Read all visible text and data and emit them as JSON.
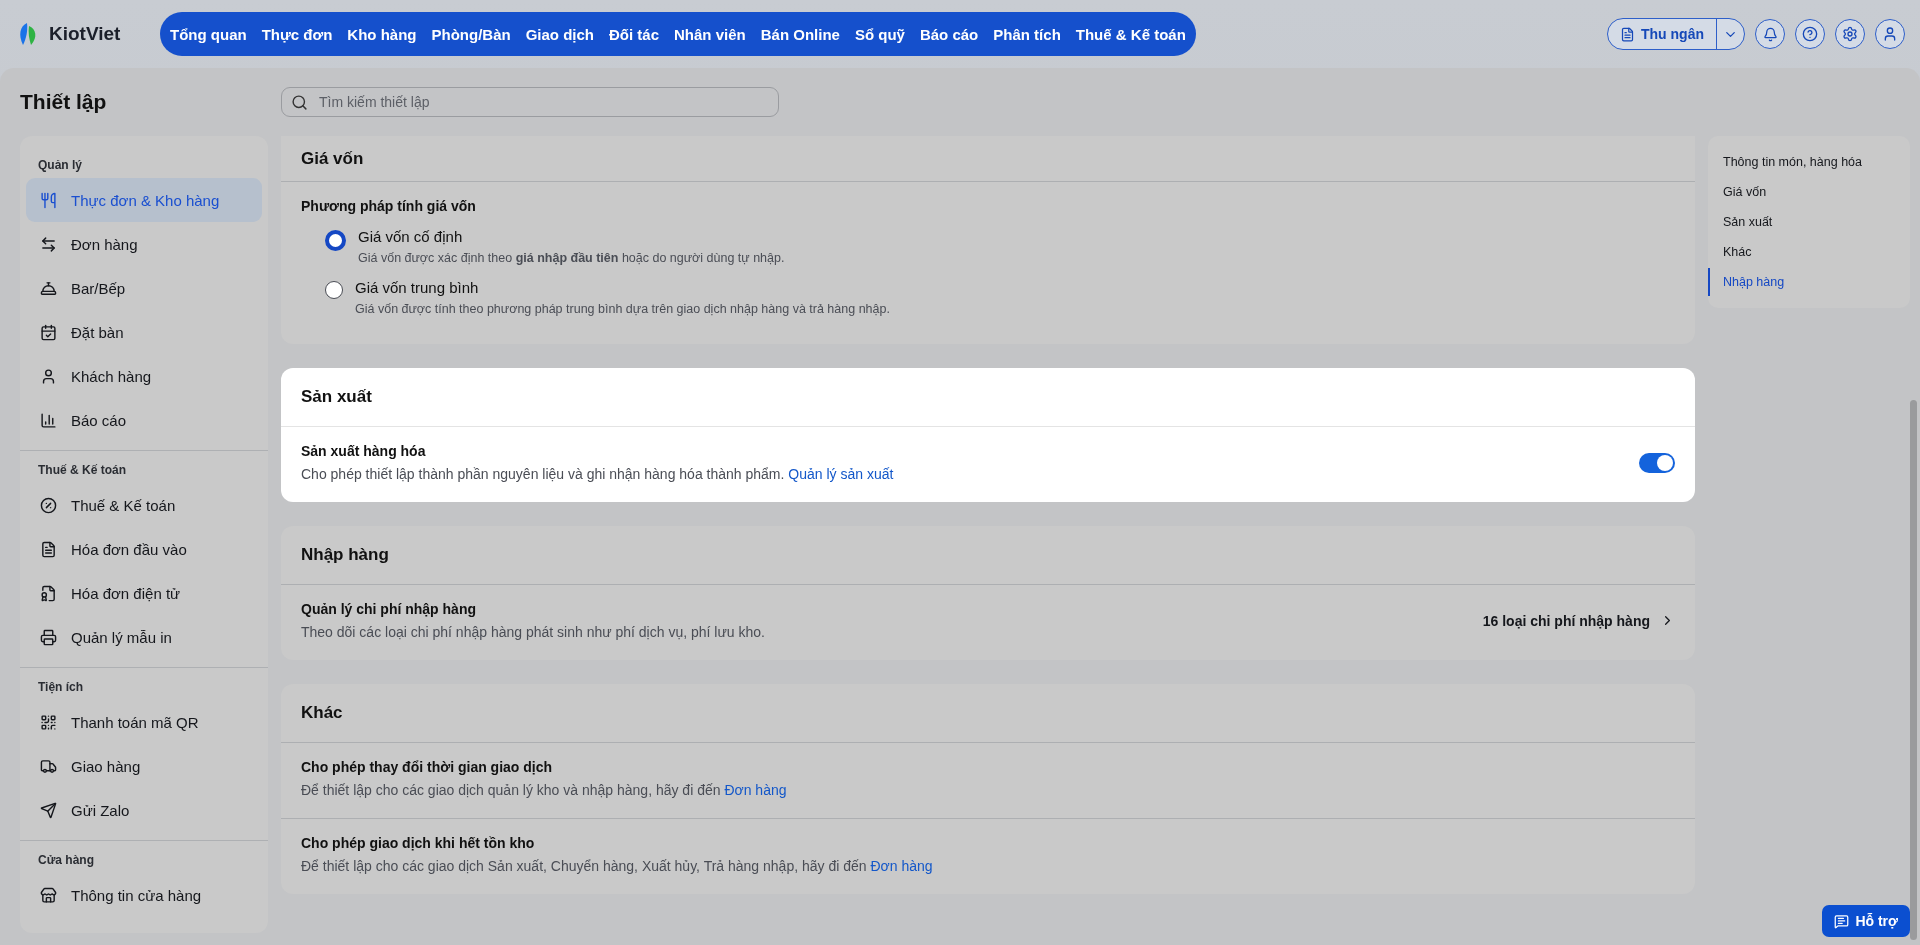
{
  "header": {
    "brand": "KiotViet",
    "nav": [
      "Tổng quan",
      "Thực đơn",
      "Kho hàng",
      "Phòng/Bàn",
      "Giao dịch",
      "Đối tác",
      "Nhân viên",
      "Bán Online",
      "Sổ quỹ",
      "Báo cáo",
      "Phân tích",
      "Thuế & Kế toán"
    ],
    "cashier": "Thu ngân"
  },
  "page_title": "Thiết lập",
  "search": {
    "placeholder": "Tìm kiếm thiết lập"
  },
  "sidebar": {
    "groups": [
      {
        "title": "Quản lý",
        "items": [
          {
            "label": "Thực đơn & Kho hàng",
            "selected": true
          },
          {
            "label": "Đơn hàng",
            "selected": false
          },
          {
            "label": "Bar/Bếp",
            "selected": false
          },
          {
            "label": "Đặt bàn",
            "selected": false
          },
          {
            "label": "Khách hàng",
            "selected": false
          },
          {
            "label": "Báo cáo",
            "selected": false
          }
        ]
      },
      {
        "title": "Thuế & Kế toán",
        "items": [
          {
            "label": "Thuế & Kế toán",
            "selected": false
          },
          {
            "label": "Hóa đơn đầu vào",
            "selected": false
          },
          {
            "label": "Hóa đơn điện tử",
            "selected": false
          },
          {
            "label": "Quản lý mẫu in",
            "selected": false
          }
        ]
      },
      {
        "title": "Tiện ích",
        "items": [
          {
            "label": "Thanh toán mã QR",
            "selected": false
          },
          {
            "label": "Giao hàng",
            "selected": false
          },
          {
            "label": "Gửi Zalo",
            "selected": false
          }
        ]
      },
      {
        "title": "Cửa hàng",
        "items": [
          {
            "label": "Thông tin cửa hàng",
            "selected": false
          }
        ]
      }
    ]
  },
  "sections": [
    {
      "title": "Giá vốn",
      "highlighted": false,
      "rows": [
        {
          "kind": "radio_group",
          "title": "Phương pháp tính giá vốn",
          "options": [
            {
              "label": "Giá vốn cố định",
              "description": "Giá vốn được xác định theo **giá nhập đầu tiên** hoặc do người dùng tự nhập.",
              "selected": true
            },
            {
              "label": "Giá vốn trung bình",
              "description": "Giá vốn được tính theo phương pháp trung bình dựa trên giao dịch nhập hàng và trả hàng nhập.",
              "selected": false
            }
          ]
        }
      ]
    },
    {
      "title": "Sản xuất",
      "highlighted": true,
      "rows": [
        {
          "kind": "toggle",
          "title": "Sản xuất hàng hóa",
          "description": "Cho phép thiết lập thành phần nguyên liệu và ghi nhận hàng hóa thành phẩm.",
          "link": "Quản lý sản xuất",
          "on": true
        }
      ]
    },
    {
      "title": "Nhập hàng",
      "highlighted": false,
      "rows": [
        {
          "kind": "summary",
          "title": "Quản lý chi phí nhập hàng",
          "description": "Theo dõi các loại chi phí nhập hàng phát sinh như phí dịch vụ, phí lưu kho.",
          "value": "16 loại chi phí nhập hàng"
        }
      ]
    },
    {
      "title": "Khác",
      "highlighted": false,
      "rows": [
        {
          "kind": "note",
          "title": "Cho phép thay đổi thời gian giao dịch",
          "description": "Để thiết lập cho các giao dịch quản lý kho và nhập hàng, hãy đi đến",
          "link": "Đơn hàng"
        },
        {
          "kind": "note",
          "title": "Cho phép giao dịch khi hết tồn kho",
          "description": "Để thiết lập cho các giao dịch Sản xuất, Chuyển hàng, Xuất hủy, Trả hàng nhập, hãy đi đến",
          "link": "Đơn hàng"
        }
      ]
    }
  ],
  "toc": [
    {
      "label": "Thông tin món, hàng hóa",
      "selected": false
    },
    {
      "label": "Giá vốn",
      "selected": false
    },
    {
      "label": "Sản xuất",
      "selected": false
    },
    {
      "label": "Khác",
      "selected": false
    },
    {
      "label": "Nhập hàng",
      "selected": true
    }
  ],
  "help": "Hỗ trợ"
}
